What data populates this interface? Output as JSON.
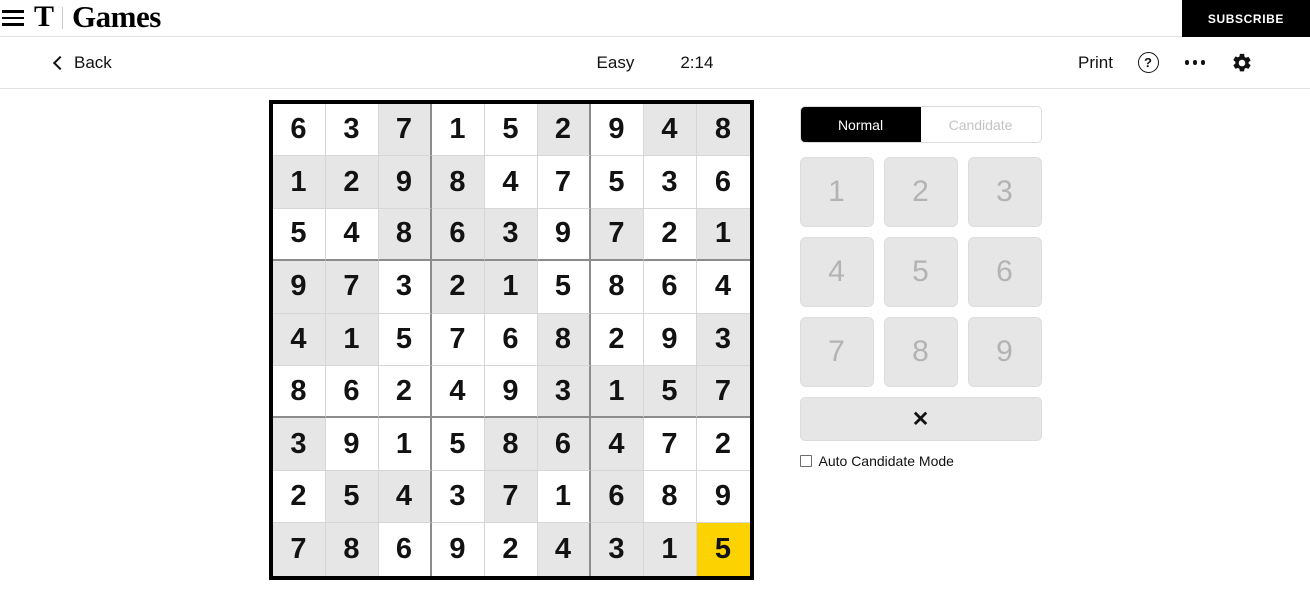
{
  "masthead": {
    "menu_icon": "hamburger-menu-icon",
    "logo_t": "T",
    "logo_word": "Games",
    "subscribe_label": "SUBSCRIBE"
  },
  "toolbar": {
    "back_label": "Back",
    "back_icon": "chevron-left-icon",
    "difficulty": "Easy",
    "timer": "2:14",
    "print_label": "Print",
    "help_icon": "help-circle-icon",
    "help_glyph": "?",
    "more_icon": "more-horizontal-icon",
    "settings_icon": "gear-icon"
  },
  "controls": {
    "mode_normal": "Normal",
    "mode_candidate": "Candidate",
    "active_mode": "Normal",
    "numbers": [
      "1",
      "2",
      "3",
      "4",
      "5",
      "6",
      "7",
      "8",
      "9"
    ],
    "erase_glyph": "✕",
    "erase_name": "erase-button",
    "auto_candidate_label": "Auto Candidate Mode",
    "auto_candidate_checked": false
  },
  "colors": {
    "selected_cell": "#fcd200",
    "filled_cell": "#e6e6e6",
    "given_cell": "#ffffff",
    "grid_border": "#000000",
    "accent_black": "#000000"
  },
  "board": {
    "selected_cell": {
      "row": 9,
      "col": 9,
      "value": "5"
    },
    "rows": [
      {
        "values": [
          "6",
          "3",
          "7",
          "1",
          "5",
          "2",
          "9",
          "4",
          "8"
        ],
        "filled": [
          false,
          false,
          true,
          false,
          false,
          true,
          false,
          true,
          true
        ]
      },
      {
        "values": [
          "1",
          "2",
          "9",
          "8",
          "4",
          "7",
          "5",
          "3",
          "6"
        ],
        "filled": [
          true,
          true,
          true,
          true,
          false,
          false,
          false,
          false,
          false
        ]
      },
      {
        "values": [
          "5",
          "4",
          "8",
          "6",
          "3",
          "9",
          "7",
          "2",
          "1"
        ],
        "filled": [
          false,
          false,
          true,
          true,
          true,
          false,
          true,
          false,
          true
        ]
      },
      {
        "values": [
          "9",
          "7",
          "3",
          "2",
          "1",
          "5",
          "8",
          "6",
          "4"
        ],
        "filled": [
          true,
          true,
          false,
          true,
          true,
          false,
          false,
          false,
          false
        ]
      },
      {
        "values": [
          "4",
          "1",
          "5",
          "7",
          "6",
          "8",
          "2",
          "9",
          "3"
        ],
        "filled": [
          true,
          true,
          false,
          false,
          false,
          true,
          false,
          false,
          true
        ]
      },
      {
        "values": [
          "8",
          "6",
          "2",
          "4",
          "9",
          "3",
          "1",
          "5",
          "7"
        ],
        "filled": [
          false,
          false,
          false,
          false,
          false,
          true,
          true,
          true,
          true
        ]
      },
      {
        "values": [
          "3",
          "9",
          "1",
          "5",
          "8",
          "6",
          "4",
          "7",
          "2"
        ],
        "filled": [
          true,
          false,
          false,
          false,
          true,
          true,
          true,
          false,
          false
        ]
      },
      {
        "values": [
          "2",
          "5",
          "4",
          "3",
          "7",
          "1",
          "6",
          "8",
          "9"
        ],
        "filled": [
          false,
          true,
          true,
          false,
          true,
          false,
          true,
          false,
          false
        ]
      },
      {
        "values": [
          "7",
          "8",
          "6",
          "9",
          "2",
          "4",
          "3",
          "1",
          "5"
        ],
        "filled": [
          true,
          true,
          false,
          false,
          false,
          true,
          true,
          true,
          false
        ]
      }
    ]
  }
}
